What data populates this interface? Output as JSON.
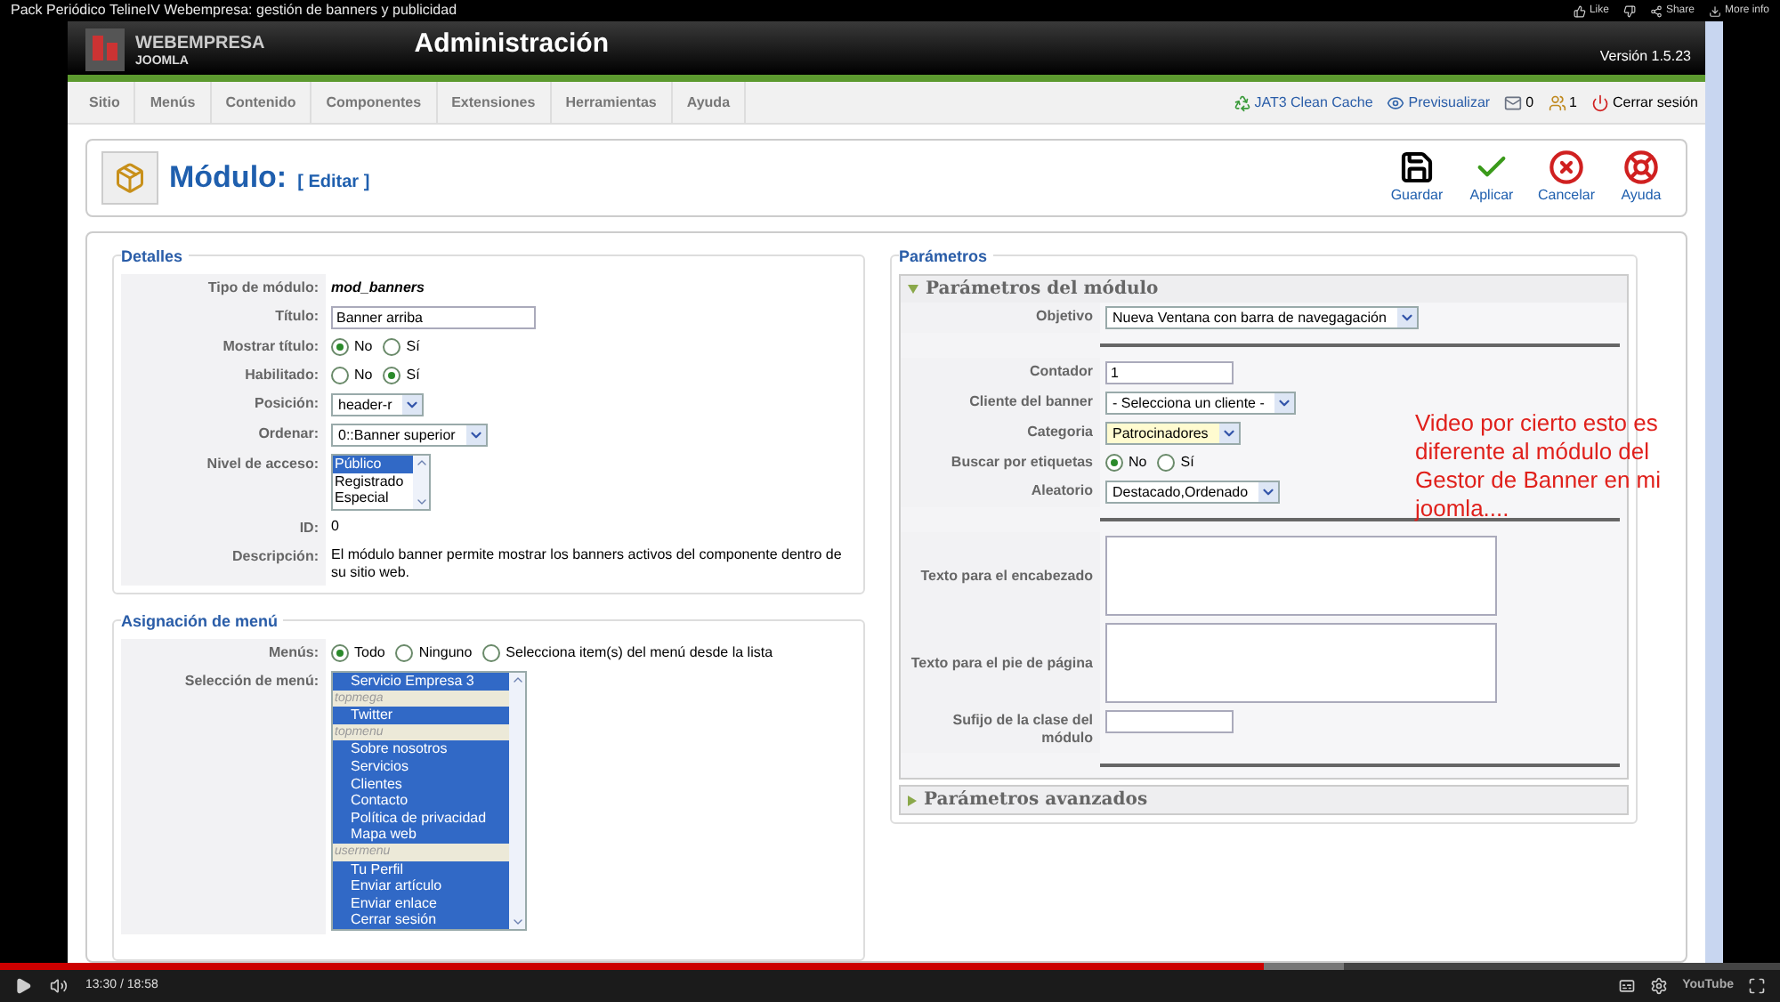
{
  "video_title": "Pack Periódico TelineIV Webempresa: gestión de banners y publicidad",
  "youtube_actions": [
    {
      "kind": "like",
      "label": "Like"
    },
    {
      "kind": "dislike"
    },
    {
      "kind": "share",
      "label": "Share"
    },
    {
      "kind": "info",
      "label": "More info"
    }
  ],
  "header": {
    "brand": "WEBEMPRESA",
    "brand_sub": "JOOMLA",
    "title": "Administración",
    "version": "Versión 1.5.23"
  },
  "menu": [
    "Sitio",
    "Menús",
    "Contenido",
    "Componentes",
    "Extensiones",
    "Herramientas",
    "Ayuda"
  ],
  "status_links": [
    {
      "kind": "cache",
      "label": "JAT3 Clean Cache"
    },
    {
      "kind": "preview",
      "label": "Previsualizar"
    },
    {
      "kind": "messages",
      "label": "0"
    },
    {
      "kind": "users",
      "label": "1"
    },
    {
      "kind": "logout",
      "label": "Cerrar sesión"
    }
  ],
  "toolbar": {
    "title": "Módulo:",
    "subtitle": "[ Editar ]",
    "buttons": [
      {
        "kind": "save",
        "label": "Guardar"
      },
      {
        "kind": "apply",
        "label": "Aplicar"
      },
      {
        "kind": "cancel",
        "label": "Cancelar"
      },
      {
        "kind": "help",
        "label": "Ayuda"
      }
    ]
  },
  "details": {
    "legend": "Detalles",
    "rows": [
      {
        "kind": "value",
        "label": "Tipo de módulo:",
        "value": "mod_banners"
      },
      {
        "kind": "input",
        "label": "Título:",
        "value": "Banner arriba"
      },
      {
        "kind": "radio",
        "label": "Mostrar título:",
        "options": [
          {
            "label": "No",
            "selected": true
          },
          {
            "label": "Sí",
            "selected": false
          }
        ]
      },
      {
        "kind": "radio",
        "label": "Habilitado:",
        "options": [
          {
            "label": "No",
            "selected": false
          },
          {
            "label": "Sí",
            "selected": true
          }
        ]
      },
      {
        "kind": "select",
        "label": "Posición:",
        "value": "header-r",
        "focused": false
      },
      {
        "kind": "select",
        "label": "Ordenar:",
        "value": "0::Banner superior",
        "focused": false
      },
      {
        "kind": "listbox",
        "label": "Nivel de acceso:",
        "options": [
          {
            "kind": "item",
            "label": "Público",
            "selected": true
          },
          {
            "kind": "item",
            "label": "Registrado",
            "selected": false
          },
          {
            "kind": "item",
            "label": "Especial",
            "selected": false
          }
        ]
      },
      {
        "kind": "text",
        "label": "ID:",
        "value": "0"
      },
      {
        "kind": "text",
        "label": "Descripción:",
        "value": "El módulo banner permite mostrar los banners activos del componente dentro de su sitio web."
      }
    ]
  },
  "menu_assignment": {
    "legend": "Asignación de menú",
    "rows": [
      {
        "kind": "radio",
        "label": "Menús:",
        "options": [
          {
            "label": "Todo",
            "selected": true
          },
          {
            "label": "Ninguno",
            "selected": false
          },
          {
            "label": "Selecciona item(s) del menú desde la lista",
            "selected": false
          }
        ]
      },
      {
        "kind": "listbox",
        "label": "Selección de menú:",
        "options": [
          {
            "kind": "item",
            "label": "Servicio Empresa 3",
            "selected": true
          },
          {
            "kind": "group",
            "label": "topmega"
          },
          {
            "kind": "item",
            "label": "Twitter",
            "selected": true
          },
          {
            "kind": "group",
            "label": "topmenu"
          },
          {
            "kind": "item",
            "label": "Sobre nosotros",
            "selected": true
          },
          {
            "kind": "item",
            "label": "Servicios",
            "selected": true
          },
          {
            "kind": "item",
            "label": "Clientes",
            "selected": true
          },
          {
            "kind": "item",
            "label": "Contacto",
            "selected": true
          },
          {
            "kind": "item",
            "label": "Política de privacidad",
            "selected": true
          },
          {
            "kind": "item",
            "label": "Mapa web",
            "selected": true
          },
          {
            "kind": "group",
            "label": "usermenu"
          },
          {
            "kind": "item",
            "label": "Tu Perfil",
            "selected": true
          },
          {
            "kind": "item",
            "label": "Enviar artículo",
            "selected": true
          },
          {
            "kind": "item",
            "label": "Enviar enlace",
            "selected": true
          },
          {
            "kind": "item",
            "label": "Cerrar sesión",
            "selected": true
          }
        ]
      }
    ]
  },
  "parameters": {
    "legend": "Parámetros",
    "sections": [
      {
        "title": "Parámetros del módulo",
        "expanded": true,
        "rows": [
          {
            "kind": "select",
            "label": "Objetivo",
            "value": "Nueva Ventana con barra de navegagación",
            "focused": false
          },
          {
            "kind": "separator"
          },
          {
            "kind": "input",
            "label": "Contador",
            "value": "1"
          },
          {
            "kind": "select",
            "label": "Cliente del banner",
            "value": "- Selecciona un cliente -",
            "focused": false
          },
          {
            "kind": "select",
            "label": "Categoria",
            "value": "Patrocinadores",
            "focused": true
          },
          {
            "kind": "radio",
            "label": "Buscar por etiquetas",
            "options": [
              {
                "label": "No",
                "selected": true
              },
              {
                "label": "Sí",
                "selected": false
              }
            ]
          },
          {
            "kind": "select",
            "label": "Aleatorio",
            "value": "Destacado,Ordenado",
            "focused": false
          },
          {
            "kind": "separator"
          },
          {
            "kind": "textarea",
            "label": "Texto para el encabezado"
          },
          {
            "kind": "textarea",
            "label": "Texto para el pie de página"
          },
          {
            "kind": "input",
            "label": "Sufijo de la clase del módulo"
          },
          {
            "kind": "separator"
          }
        ]
      },
      {
        "title": "Parámetros avanzados",
        "expanded": false
      }
    ]
  },
  "annotation": "Video por cierto esto es diferente al módulo del Gestor de Banner en mi joomla....",
  "player": {
    "time": "13:30 / 18:58",
    "level": 0.71,
    "logo": "YouTube"
  }
}
